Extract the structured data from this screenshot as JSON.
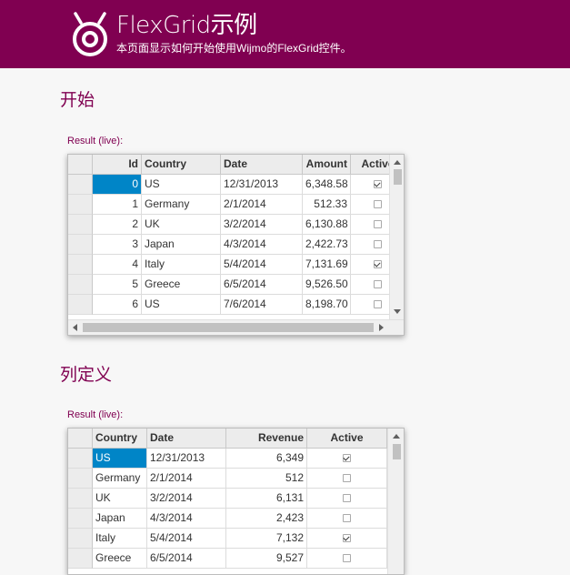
{
  "header": {
    "title": "FlexGrid示例",
    "subtitle": "本页面显示如何开始使用Wijmo的FlexGrid控件。"
  },
  "section1": {
    "title": "开始",
    "result_label": "Result (live):",
    "columns": [
      "Id",
      "Country",
      "Date",
      "Amount",
      "Active"
    ],
    "rows": [
      {
        "id": "0",
        "country": "US",
        "date": "12/31/2013",
        "amount": "6,348.58",
        "active": true
      },
      {
        "id": "1",
        "country": "Germany",
        "date": "2/1/2014",
        "amount": "512.33",
        "active": false
      },
      {
        "id": "2",
        "country": "UK",
        "date": "3/2/2014",
        "amount": "6,130.88",
        "active": false
      },
      {
        "id": "3",
        "country": "Japan",
        "date": "4/3/2014",
        "amount": "2,422.73",
        "active": false
      },
      {
        "id": "4",
        "country": "Italy",
        "date": "5/4/2014",
        "amount": "7,131.69",
        "active": true
      },
      {
        "id": "5",
        "country": "Greece",
        "date": "6/5/2014",
        "amount": "9,526.50",
        "active": false
      },
      {
        "id": "6",
        "country": "US",
        "date": "7/6/2014",
        "amount": "8,198.70",
        "active": false
      }
    ]
  },
  "section2": {
    "title": "列定义",
    "result_label": "Result (live):",
    "columns": [
      "Country",
      "Date",
      "Revenue",
      "Active"
    ],
    "rows": [
      {
        "country": "US",
        "date": "12/31/2013",
        "revenue": "6,349",
        "active": true
      },
      {
        "country": "Germany",
        "date": "2/1/2014",
        "revenue": "512",
        "active": false
      },
      {
        "country": "UK",
        "date": "3/2/2014",
        "revenue": "6,131",
        "active": false
      },
      {
        "country": "Japan",
        "date": "4/3/2014",
        "revenue": "2,423",
        "active": false
      },
      {
        "country": "Italy",
        "date": "5/4/2014",
        "revenue": "7,132",
        "active": true
      },
      {
        "country": "Greece",
        "date": "6/5/2014",
        "revenue": "9,527",
        "active": false
      }
    ]
  }
}
